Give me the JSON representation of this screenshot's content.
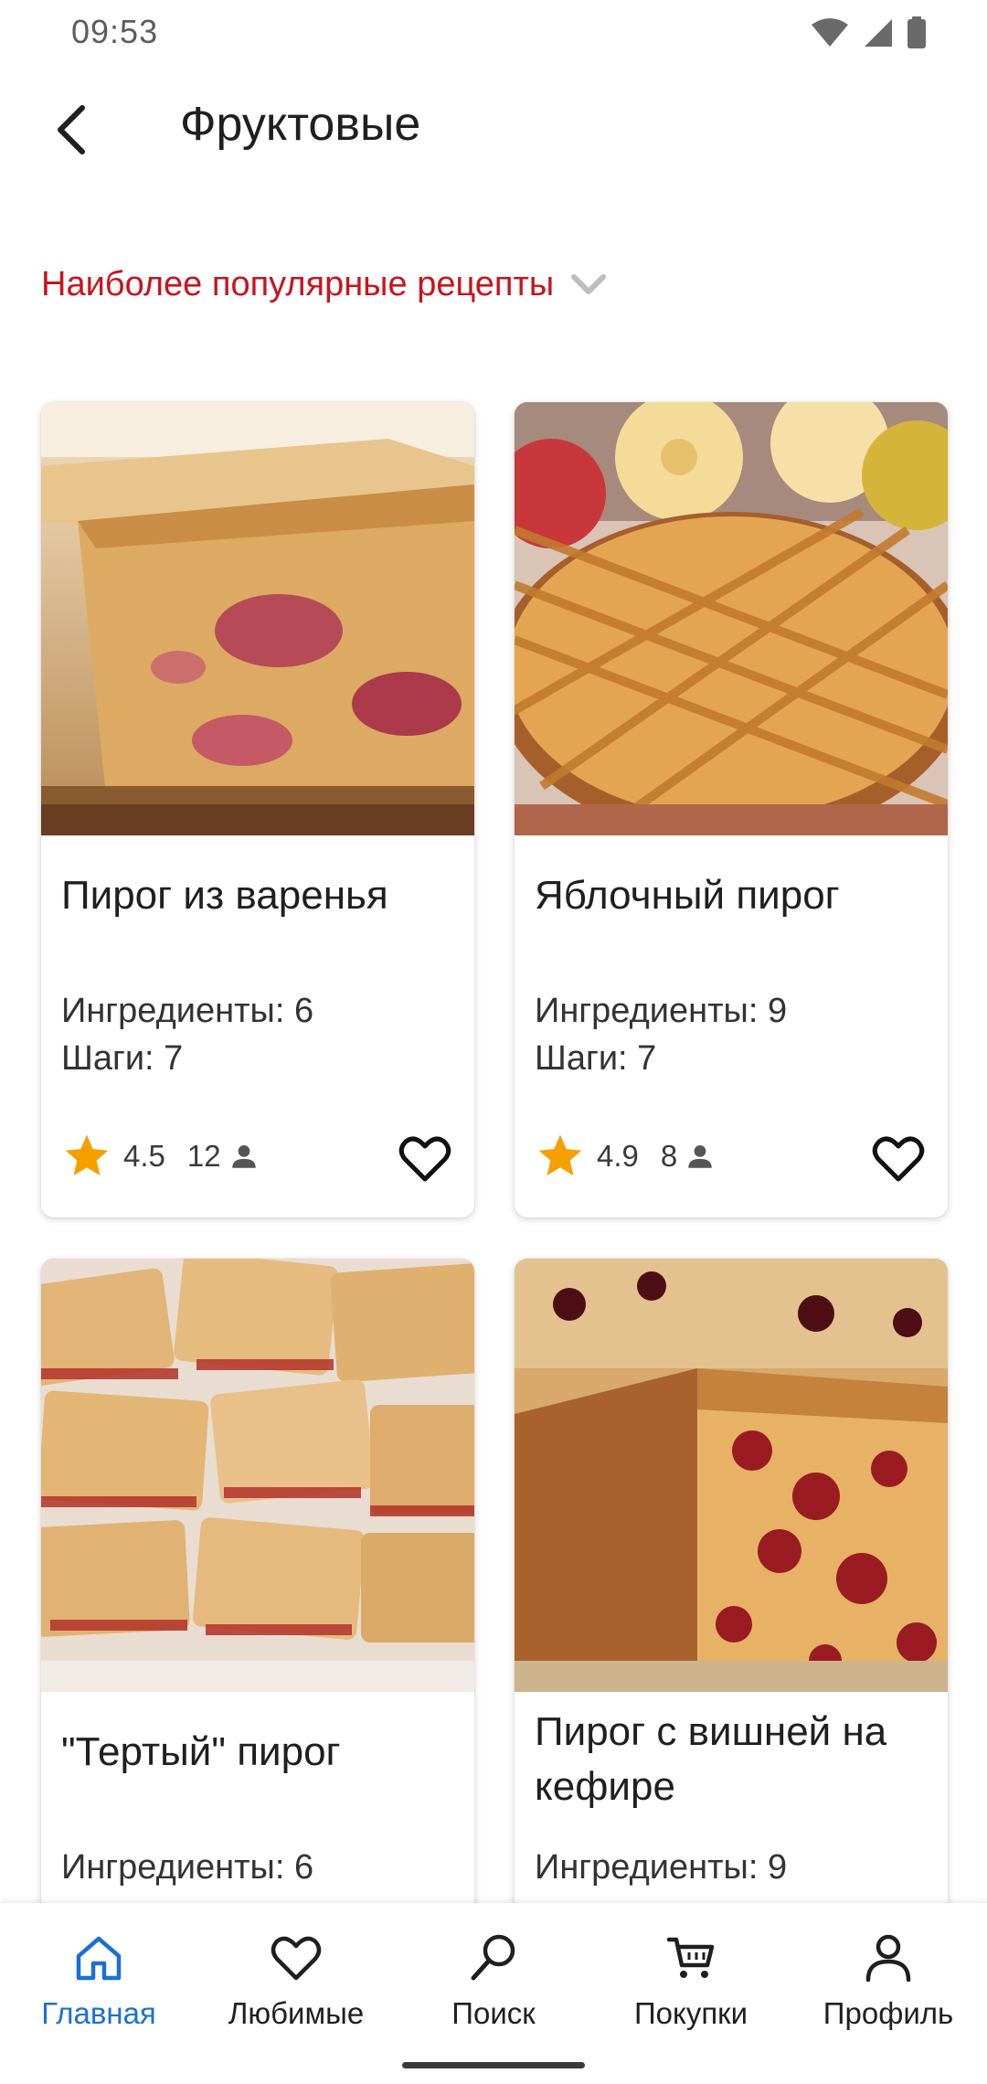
{
  "status_bar": {
    "time": "09:53"
  },
  "header": {
    "title": "Фруктовые"
  },
  "sort": {
    "label": "Наиболее популярные рецепты"
  },
  "colors": {
    "accent_red": "#c8141e",
    "active_blue": "#1d6fd6",
    "star": "#f5a000"
  },
  "recipes": [
    {
      "title": "Пирог из варенья",
      "ingredients": "Ингредиенты: 6",
      "steps": "Шаги: 7",
      "rating": "4.5",
      "votes": "12"
    },
    {
      "title": "Яблочный пирог",
      "ingredients": "Ингредиенты: 9",
      "steps": "Шаги: 7",
      "rating": "4.9",
      "votes": "8"
    },
    {
      "title": "\"Тертый\" пирог",
      "ingredients": "Ингредиенты: 6",
      "steps": ""
    },
    {
      "title": "Пирог с вишней на кефире",
      "ingredients": "Ингредиенты: 9",
      "steps": ""
    }
  ],
  "bottom_nav": {
    "items": [
      {
        "label": "Главная",
        "icon": "home-icon",
        "active": true
      },
      {
        "label": "Любимые",
        "icon": "heart-icon",
        "active": false
      },
      {
        "label": "Поиск",
        "icon": "search-icon",
        "active": false
      },
      {
        "label": "Покупки",
        "icon": "cart-icon",
        "active": false
      },
      {
        "label": "Профиль",
        "icon": "profile-icon",
        "active": false
      }
    ]
  }
}
